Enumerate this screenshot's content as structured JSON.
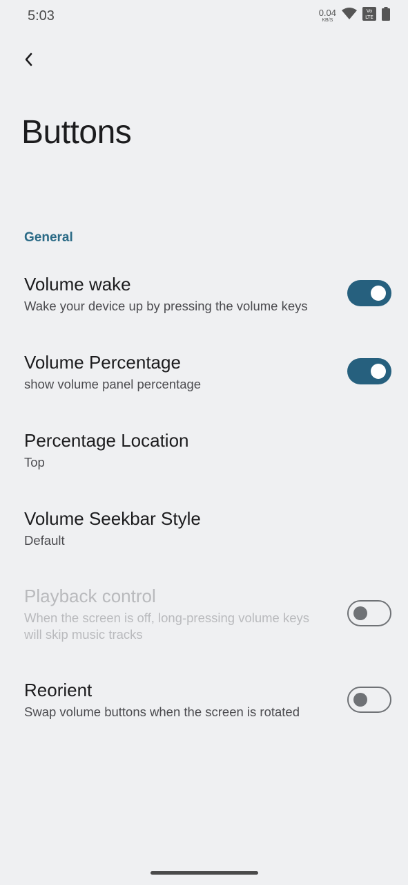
{
  "status_bar": {
    "time": "5:03",
    "net_speed_value": "0.04",
    "net_speed_unit": "KB/S",
    "icons": [
      "wifi-icon",
      "volte-icon",
      "battery-icon"
    ]
  },
  "header": {
    "back_icon": "chevron-left-icon",
    "title": "Buttons"
  },
  "section": {
    "label": "General"
  },
  "preferences": [
    {
      "title": "Volume wake",
      "summary": "Wake your device up by pressing the volume keys",
      "switch": "on"
    },
    {
      "title": "Volume Percentage",
      "summary": "show volume panel percentage",
      "switch": "on"
    },
    {
      "title": "Percentage Location",
      "summary": "Top"
    },
    {
      "title": "Volume Seekbar Style",
      "summary": "Default"
    },
    {
      "title": "Playback control",
      "summary": "When the screen is off, long-pressing volume keys will skip music tracks",
      "switch": "off",
      "disabled": true
    },
    {
      "title": "Reorient",
      "summary": "Swap volume buttons when the screen is rotated",
      "switch": "off"
    }
  ],
  "colors": {
    "background": "#eff0f2",
    "accent": "#26607e",
    "section_header": "#2a6a86"
  }
}
